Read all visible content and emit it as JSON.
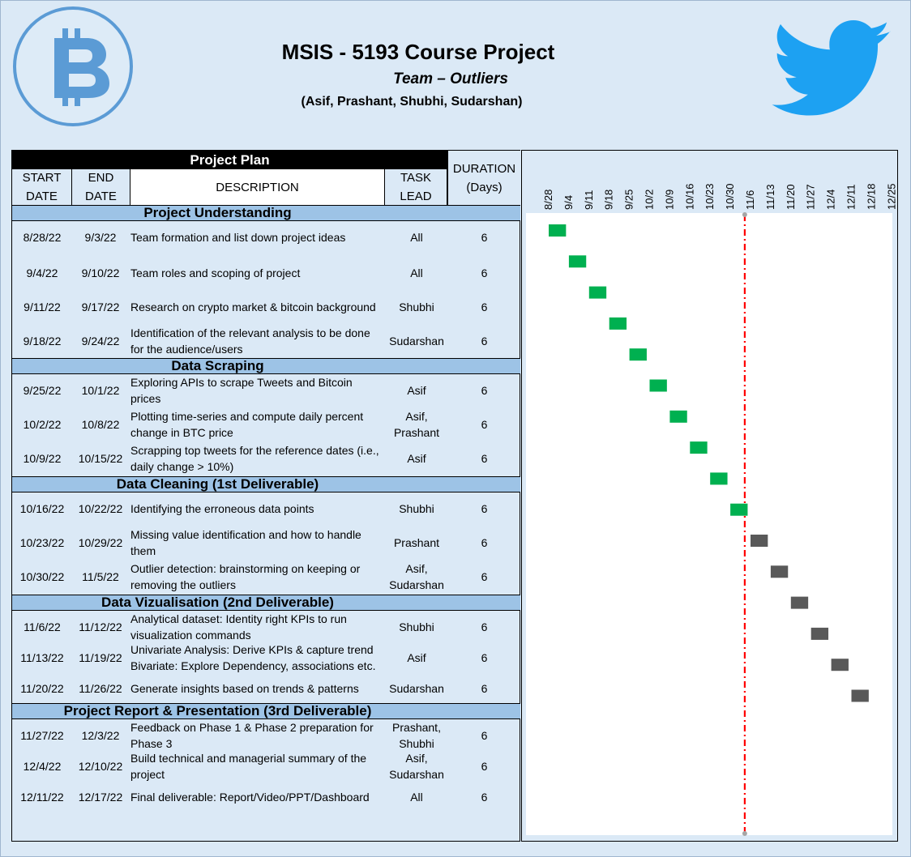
{
  "header": {
    "title": "MSIS - 5193 Course Project",
    "team": "Team – Outliers",
    "members": "(Asif, Prashant, Shubhi, Sudarshan)",
    "left_logo": "bitcoin-logo-icon",
    "right_logo": "twitter-bird-icon"
  },
  "colors": {
    "background": "#dbe9f6",
    "section_band": "#9dc3e6",
    "bar_done": "#00b050",
    "bar_planned": "#595959",
    "today_line": "#ff0000",
    "bitcoin_blue": "#5b9bd5",
    "twitter_blue": "#1da1f2"
  },
  "table": {
    "plan_title": "Project Plan",
    "columns": {
      "start": "START\nDATE",
      "end": "END\nDATE",
      "description": "DESCRIPTION",
      "lead": "TASK\nLEAD",
      "duration": "DURATION\n(Days)"
    },
    "sections": [
      {
        "title": "Project Understanding",
        "rows": [
          {
            "start": "8/28/22",
            "end": "9/3/22",
            "description": "Team formation and list down project ideas",
            "lead": "All",
            "duration": "6"
          },
          {
            "start": "9/4/22",
            "end": "9/10/22",
            "description": "Team roles and scoping of project",
            "lead": "All",
            "duration": "6"
          },
          {
            "start": "9/11/22",
            "end": "9/17/22",
            "description": "Research on crypto market & bitcoin background",
            "lead": "Shubhi",
            "duration": "6"
          },
          {
            "start": "9/18/22",
            "end": "9/24/22",
            "description": "Identification of the relevant analysis to be done for the  audience/users",
            "lead": "Sudarshan",
            "duration": "6"
          }
        ]
      },
      {
        "title": "Data Scraping",
        "rows": [
          {
            "start": "9/25/22",
            "end": "10/1/22",
            "description": "Exploring APIs to scrape Tweets and Bitcoin prices",
            "lead": "Asif",
            "duration": "6"
          },
          {
            "start": "10/2/22",
            "end": "10/8/22",
            "description": "Plotting time-series and compute daily percent change in BTC price",
            "lead": "Asif,\nPrashant",
            "duration": "6"
          },
          {
            "start": "10/9/22",
            "end": "10/15/22",
            "description": "Scrapping top tweets for the reference dates (i.e., daily change > 10%)",
            "lead": "Asif",
            "duration": "6"
          }
        ]
      },
      {
        "title": "Data Cleaning (1st Deliverable)",
        "rows": [
          {
            "start": "10/16/22",
            "end": "10/22/22",
            "description": "Identifying the erroneous data points",
            "lead": "Shubhi",
            "duration": "6"
          },
          {
            "start": "10/23/22",
            "end": "10/29/22",
            "description": "Missing value identification and how to handle them",
            "lead": "Prashant",
            "duration": "6"
          },
          {
            "start": "10/30/22",
            "end": "11/5/22",
            "description": "Outlier detection: brainstorming on keeping or removing the outliers",
            "lead": "Asif,\nSudarshan",
            "duration": "6"
          }
        ]
      },
      {
        "title": "Data Vizualisation (2nd Deliverable)",
        "rows": [
          {
            "start": "11/6/22",
            "end": "11/12/22",
            "description": "Analytical dataset: Identity right KPIs to run visualization commands",
            "lead": "Shubhi",
            "duration": "6"
          },
          {
            "start": "11/13/22",
            "end": "11/19/22",
            "description": "Univariate Analysis: Derive KPIs & capture trend Bivariate: Explore Dependency, associations etc.",
            "lead": "Asif",
            "duration": "6"
          },
          {
            "start": "11/20/22",
            "end": "11/26/22",
            "description": "Generate insights based on trends & patterns",
            "lead": "Sudarshan",
            "duration": "6"
          }
        ]
      },
      {
        "title": "Project Report & Presentation (3rd Deliverable)",
        "rows": [
          {
            "start": "11/27/22",
            "end": "12/3/22",
            "description": "Feedback on Phase 1 & Phase 2 preparation for Phase 3",
            "lead": "Prashant,\nShubhi",
            "duration": "6"
          },
          {
            "start": "12/4/22",
            "end": "12/10/22",
            "description": "Build technical and managerial summary of the project",
            "lead": "Asif,\nSudarshan",
            "duration": "6"
          },
          {
            "start": "12/11/22",
            "end": "12/17/22",
            "description": "Final deliverable: Report/Video/PPT/Dashboard",
            "lead": "All",
            "duration": "6"
          }
        ]
      }
    ]
  },
  "chart_data": {
    "type": "gantt",
    "x_ticks": [
      "8/28",
      "9/4",
      "9/11",
      "9/18",
      "9/25",
      "10/2",
      "10/9",
      "10/16",
      "10/23",
      "10/30",
      "11/6",
      "11/13",
      "11/20",
      "11/27",
      "12/4",
      "12/11",
      "12/18",
      "12/25"
    ],
    "xlim": [
      "8/28",
      "12/25"
    ],
    "today_marker": "11/4",
    "tasks": [
      {
        "start": "8/28",
        "end": "9/3",
        "status": "done"
      },
      {
        "start": "9/4",
        "end": "9/10",
        "status": "done"
      },
      {
        "start": "9/11",
        "end": "9/17",
        "status": "done"
      },
      {
        "start": "9/18",
        "end": "9/24",
        "status": "done"
      },
      {
        "start": "9/25",
        "end": "10/1",
        "status": "done"
      },
      {
        "start": "10/2",
        "end": "10/8",
        "status": "done"
      },
      {
        "start": "10/9",
        "end": "10/15",
        "status": "done"
      },
      {
        "start": "10/16",
        "end": "10/22",
        "status": "done"
      },
      {
        "start": "10/23",
        "end": "10/29",
        "status": "done"
      },
      {
        "start": "10/30",
        "end": "11/5",
        "status": "done"
      },
      {
        "start": "11/6",
        "end": "11/12",
        "status": "planned"
      },
      {
        "start": "11/13",
        "end": "11/19",
        "status": "planned"
      },
      {
        "start": "11/20",
        "end": "11/26",
        "status": "planned"
      },
      {
        "start": "11/27",
        "end": "12/3",
        "status": "planned"
      },
      {
        "start": "12/4",
        "end": "12/10",
        "status": "planned"
      },
      {
        "start": "12/11",
        "end": "12/17",
        "status": "planned"
      }
    ],
    "grid": false,
    "legend": "none"
  }
}
